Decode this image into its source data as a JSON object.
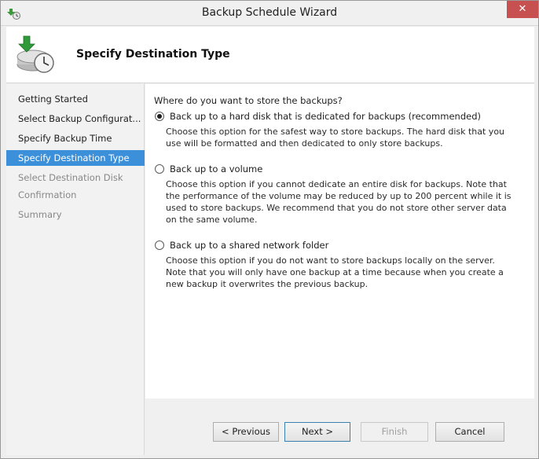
{
  "window": {
    "title": "Backup Schedule Wizard",
    "close_glyph": "✕"
  },
  "header": {
    "title": "Specify Destination Type",
    "icon": "backup-clock-icon"
  },
  "nav": {
    "items": [
      {
        "label": "Getting Started",
        "state": "normal"
      },
      {
        "label": "Select Backup Configurat...",
        "state": "normal"
      },
      {
        "label": "Specify Backup Time",
        "state": "normal"
      },
      {
        "label": "Specify Destination Type",
        "state": "active"
      },
      {
        "label": "Select Destination Disk",
        "state": "disabled"
      },
      {
        "label": "Confirmation",
        "state": "disabled"
      },
      {
        "label": "Summary",
        "state": "disabled"
      }
    ]
  },
  "content": {
    "question": "Where do you want to store the backups?",
    "options": [
      {
        "label": "Back up to a hard disk that is dedicated for backups (recommended)",
        "selected": true,
        "description": "Choose this option for the safest way to store backups. The hard disk that you use will be formatted and then dedicated to only store backups."
      },
      {
        "label": "Back up to a volume",
        "selected": false,
        "description": "Choose this option if you cannot dedicate an entire disk for backups. Note that the performance of the volume may be reduced by up to 200 percent while it is used to store backups. We recommend that you do not store other server data on the same volume."
      },
      {
        "label": "Back up to a shared network folder",
        "selected": false,
        "description": "Choose this option if you do not want to store backups locally on the server. Note that you will only have one backup at a time because when you create a new backup it overwrites the previous backup."
      }
    ]
  },
  "buttons": {
    "previous": "< Previous",
    "next": "Next >",
    "finish": "Finish",
    "cancel": "Cancel"
  },
  "colors": {
    "accent": "#3c8fd9",
    "close": "#c75050"
  }
}
